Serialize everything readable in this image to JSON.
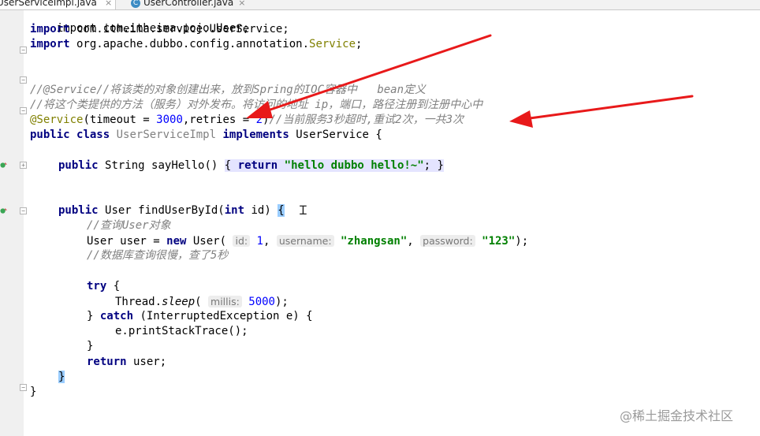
{
  "tabs": [
    {
      "label": "UserServiceImpl.java",
      "close": "×",
      "active": true
    },
    {
      "label": "UserController.java",
      "close": "×",
      "active": false,
      "icon": "class-c-icon"
    }
  ],
  "code": {
    "l0": "import com.itheima.pojo.User;",
    "import1": {
      "kw": "import",
      "rest": " com.itheima.service.UserService;"
    },
    "import2": {
      "kw": "import",
      "rest": " org.apache.dubbo.config.annotation.",
      "cls": "Service",
      "end": ";"
    },
    "comment1": {
      "a": "//@Service//将该类的对象创建出来，放到",
      "b": "Spring",
      "c": "的",
      "d": "IOC",
      "e": "容器中   ",
      "f": "bean",
      "g": "定义"
    },
    "comment2": "//将这个类提供的方法（服务）对外发布。将访问的地址 ip，端口，路径注册到注册中心中",
    "annotation": {
      "ann": "@Service",
      "p1": "(timeout = ",
      "n1": "3000",
      "p2": ",retries = ",
      "n2": "2",
      "p3": ")",
      "cmt": "//当前服务3秒超时,重试2次，一共3次"
    },
    "classdecl": {
      "kw1": "public",
      "kw2": "class",
      "name": "UserServiceImpl",
      "kw3": "implements",
      "iface": "UserService",
      "brace": "{"
    },
    "sayHello": {
      "kw1": "public",
      "type": "String",
      "sig": "sayHello()",
      "o": "{",
      "kw2": "return",
      "str": "\"hello dubbo hello!~\"",
      "semi": ";",
      "c": "}"
    },
    "findUser": {
      "kw1": "public",
      "sig": "User findUserById(",
      "kw2": "int",
      "sig2": " id) ",
      "brace": "{"
    },
    "cmtQuery": "//查询User对象",
    "newUser": {
      "a": "User user = ",
      "kw": "new",
      "b": " User( ",
      "h1": "id:",
      "n1": "1",
      "c": ", ",
      "h2": "username:",
      "s1": "\"zhangsan\"",
      "d": ", ",
      "h3": "password:",
      "s2": "\"123\"",
      "e": ");"
    },
    "cmtSlow": "//数据库查询很慢，查了5秒",
    "try": {
      "kw": "try",
      "b": " {"
    },
    "sleep": {
      "a": "Thread.",
      "m": "sleep",
      "b": "( ",
      "h": "millis:",
      "n": "5000",
      "c": ");"
    },
    "catch": {
      "a": "} ",
      "kw": "catch",
      "b": " (InterruptedException e) {"
    },
    "printStack": "e.printStackTrace();",
    "closeTry": "}",
    "ret": {
      "kw": "return",
      "b": " user;"
    },
    "closeMethod": "}",
    "closeClass": "}"
  },
  "watermark": "@稀土掘金技术社区",
  "colors": {
    "keyword": "#000080",
    "annotation": "#808000",
    "number": "#0000ff",
    "string": "#008000",
    "comment": "#808080",
    "arrow": "#e8191a"
  }
}
